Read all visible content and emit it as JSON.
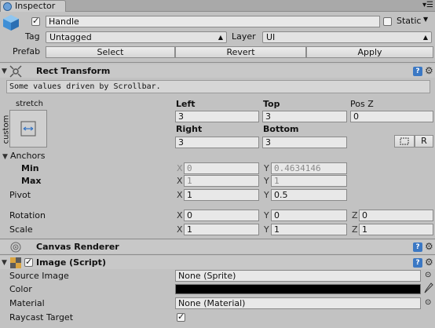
{
  "window": {
    "tab_label": "Inspector"
  },
  "gameobject": {
    "name": "Handle",
    "static_label": "Static",
    "tag_label": "Tag",
    "tag_value": "Untagged",
    "layer_label": "Layer",
    "layer_value": "UI",
    "prefab_label": "Prefab",
    "prefab_buttons": [
      "Select",
      "Revert",
      "Apply"
    ]
  },
  "rect_transform": {
    "title": "Rect Transform",
    "info": "Some values driven by Scrollbar.",
    "anchor_preset_top": "stretch",
    "anchor_preset_side": "custom",
    "headers": {
      "left": "Left",
      "top": "Top",
      "posz": "Pos Z",
      "right": "Right",
      "bottom": "Bottom"
    },
    "values": {
      "left": "3",
      "top": "3",
      "posz": "0",
      "right": "3",
      "bottom": "3"
    },
    "raw_button": "R",
    "anchors_label": "Anchors",
    "min_label": "Min",
    "min_x": "0",
    "min_y": "0.4634146",
    "max_label": "Max",
    "max_x": "1",
    "max_y": "1",
    "pivot_label": "Pivot",
    "pivot_x": "1",
    "pivot_y": "0.5",
    "rotation_label": "Rotation",
    "rotation": {
      "x": "0",
      "y": "0",
      "z": "0"
    },
    "scale_label": "Scale",
    "scale": {
      "x": "1",
      "y": "1",
      "z": "1"
    },
    "axis_labels": {
      "x": "X",
      "y": "Y",
      "z": "Z"
    }
  },
  "canvas_renderer": {
    "title": "Canvas Renderer"
  },
  "image_script": {
    "title": "Image (Script)",
    "source_image_label": "Source Image",
    "source_image_value": "None (Sprite)",
    "color_label": "Color",
    "color_value": "#000000",
    "material_label": "Material",
    "material_value": "None (Material)",
    "raycast_label": "Raycast Target",
    "raycast_checked": true
  },
  "colors": {
    "accent_help": "#3b78c4",
    "panel_bg": "#c2c2c2"
  }
}
